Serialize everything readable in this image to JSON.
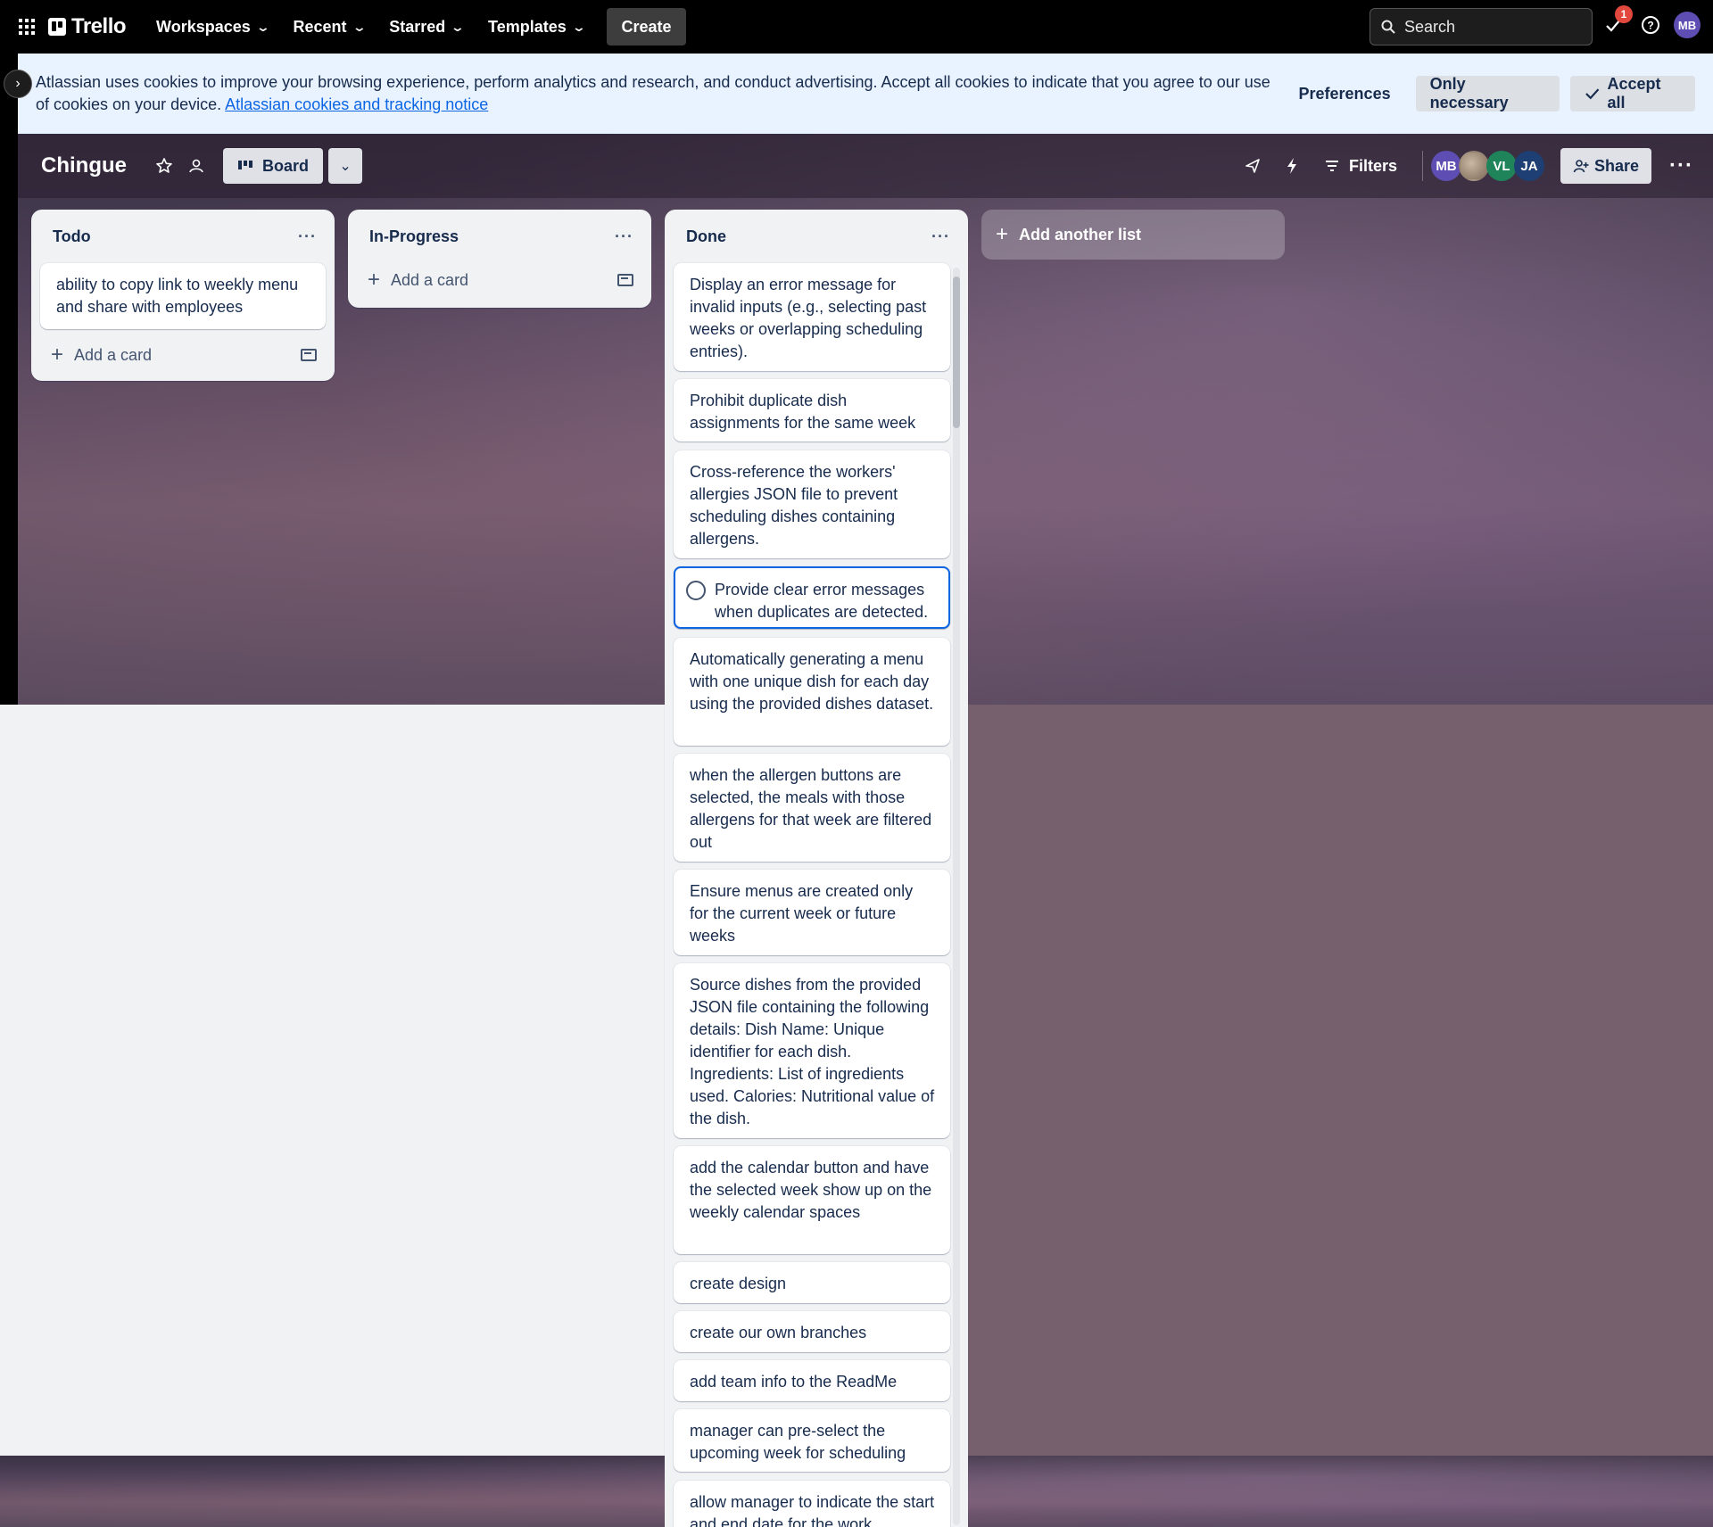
{
  "topnav": {
    "logo": "Trello",
    "menus": [
      "Workspaces",
      "Recent",
      "Starred",
      "Templates"
    ],
    "create": "Create",
    "search_placeholder": "Search",
    "notifications_count": "1",
    "user_initials": "MB"
  },
  "cookie": {
    "text": "Atlassian uses cookies to improve your browsing experience, perform analytics and research, and conduct advertising. Accept all cookies to indicate that you agree to our use of cookies on your device.",
    "link": "Atlassian cookies and tracking notice",
    "preferences": "Preferences",
    "only_necessary": "Only necessary",
    "accept_all": "Accept all"
  },
  "board": {
    "title": "Chingue",
    "view": "Board",
    "filters": "Filters",
    "share": "Share",
    "members": [
      {
        "initials": "MB",
        "color": "#5e4db2"
      },
      {
        "initials": "",
        "color": "#8f7f74"
      },
      {
        "initials": "VL",
        "color": "#1f845a"
      },
      {
        "initials": "JA",
        "color": "#1d3f73"
      }
    ]
  },
  "lists": [
    {
      "title": "Todo",
      "add_card": "Add a card",
      "cards": [
        "ability to copy link to weekly menu and share with employees"
      ]
    },
    {
      "title": "In-Progress",
      "add_card": "Add a card",
      "cards": []
    },
    {
      "title": "Done",
      "cards": [
        "Display an error message for invalid inputs (e.g., selecting past weeks or overlapping scheduling entries).",
        "Prohibit duplicate dish assignments for the same week",
        "Cross-reference the workers' allergies JSON file to prevent scheduling dishes containing allergens.",
        "Provide clear error messages when duplicates are detected.",
        "Automatically generating a menu with one unique dish for each day using the provided dishes dataset.",
        "when the allergen buttons are selected, the meals with those allergens for that week are filtered out",
        "Ensure menus are created only for the current week or future weeks",
        "Source dishes from the provided JSON file containing the following details: Dish Name: Unique identifier for each dish. Ingredients: List of ingredients used. Calories: Nutritional value of the dish.",
        "add the calendar button and have the selected week show up on the weekly calendar spaces",
        "create design",
        "create our own branches",
        "add team info to the ReadMe",
        "manager can pre-select the upcoming week for scheduling",
        "allow manager to indicate the start and end date for the work"
      ]
    }
  ],
  "add_list": "Add another list"
}
